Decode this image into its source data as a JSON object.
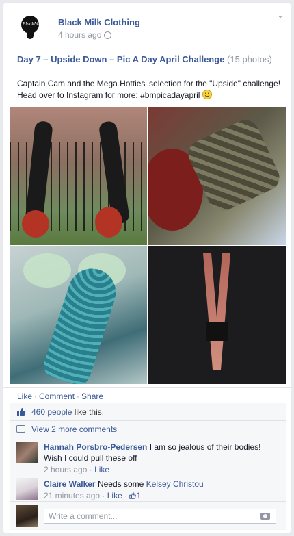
{
  "post": {
    "page_name": "Black Milk Clothing",
    "avatar_text": "BlackMilk",
    "time": "4 hours ago",
    "album_title": "Day 7 – Upside Down – Pic A Day April Challenge",
    "photo_count": "(15 photos)",
    "caption": "Captain Cam and the Mega Hotties' selection for the \"Upside\" challenge! Head over to Instagram for more: #bmpicadayapril",
    "chevron": "⌄"
  },
  "actions": {
    "like": "Like",
    "comment": "Comment",
    "share": "Share",
    "separator": "·"
  },
  "likes": {
    "people_link": "460 people",
    "suffix": " like this."
  },
  "view_more": "View 2 more comments",
  "comments": [
    {
      "name": "Hannah Porsbro-Pedersen",
      "text": "I am so jealous of their bodies! Wish I could pull these off",
      "time": "2 hours ago",
      "like": "Like"
    },
    {
      "name": "Claire Walker",
      "text": "Needs some",
      "mention": "Kelsey Christou",
      "time": "21 minutes ago",
      "like": "Like",
      "like_count": "1"
    }
  ],
  "composer": {
    "placeholder": "Write a comment..."
  },
  "colors": {
    "link": "#3b5998",
    "muted": "#9197a3",
    "background": "#e9eaed"
  }
}
